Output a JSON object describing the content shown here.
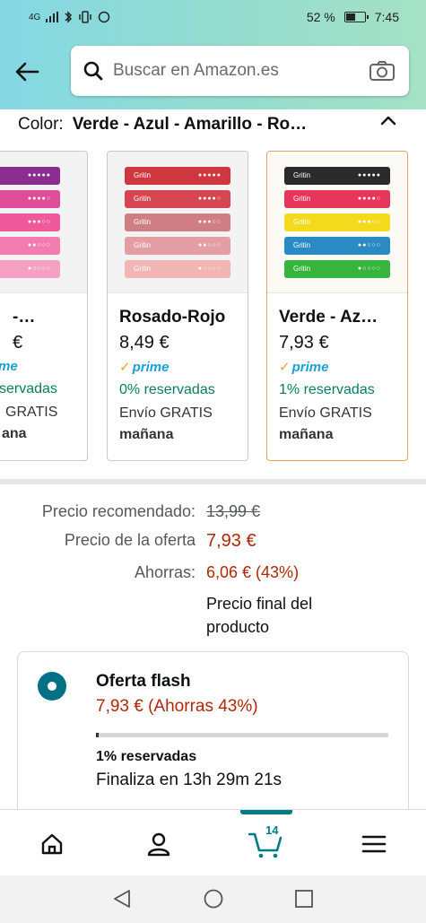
{
  "status_bar": {
    "network": "4G",
    "battery_text": "52 %",
    "battery_level": 0.52,
    "time": "7:45"
  },
  "header": {
    "search_placeholder": "Buscar en Amazon.es"
  },
  "color_selector": {
    "label": "Color:",
    "value": "Verde - Azul - Amarillo - Ro…"
  },
  "variants": [
    {
      "name": "-…",
      "price": "€",
      "prime": "me",
      "reserved": "servadas",
      "shipping": "GRATIS",
      "day": "ana",
      "bands": [
        "#8b2d8f",
        "#e04b9a",
        "#f05a9a",
        "#f27cb0",
        "#f5a0c2"
      ],
      "selected": false
    },
    {
      "name": "Rosado-Rojo",
      "price": "8,49 €",
      "prime": "prime",
      "reserved": "0% reservadas",
      "shipping": "Envío GRATIS",
      "day": "mañana",
      "bands": [
        "#d0363e",
        "#d64650",
        "#cf7e86",
        "#e49da2",
        "#f1b5b3"
      ],
      "selected": false
    },
    {
      "name": "Verde - Az…",
      "price": "7,93 €",
      "prime": "prime",
      "reserved": "1% reservadas",
      "shipping": "Envío GRATIS",
      "day": "mañana",
      "bands": [
        "#2a2a2a",
        "#e8355a",
        "#f3da1c",
        "#2a8ac4",
        "#36b43c"
      ],
      "selected": true
    }
  ],
  "band_label": "Gritin",
  "pricing": {
    "recommended_label": "Precio recomendado:",
    "recommended_value": "13,99 €",
    "offer_label": "Precio de la oferta",
    "offer_value": "7,93 €",
    "savings_label": "Ahorras:",
    "savings_value": "6,06 € (43%)",
    "final_note_line1": "Precio final del",
    "final_note_line2": "producto"
  },
  "deal": {
    "title": "Oferta flash",
    "price_text": "7,93 € (Ahorras 43%)",
    "claimed_fraction": 0.01,
    "claimed_text": "1% reservadas",
    "ends_text": "Finaliza en 13h 29m 21s"
  },
  "tabbar": {
    "cart_count": "14"
  },
  "colors": {
    "accent": "#007185",
    "deal_red": "#b12704",
    "reserved_green": "#067d62",
    "prime_blue": "#1aa0d6",
    "selected_border": "#e7a35a"
  }
}
